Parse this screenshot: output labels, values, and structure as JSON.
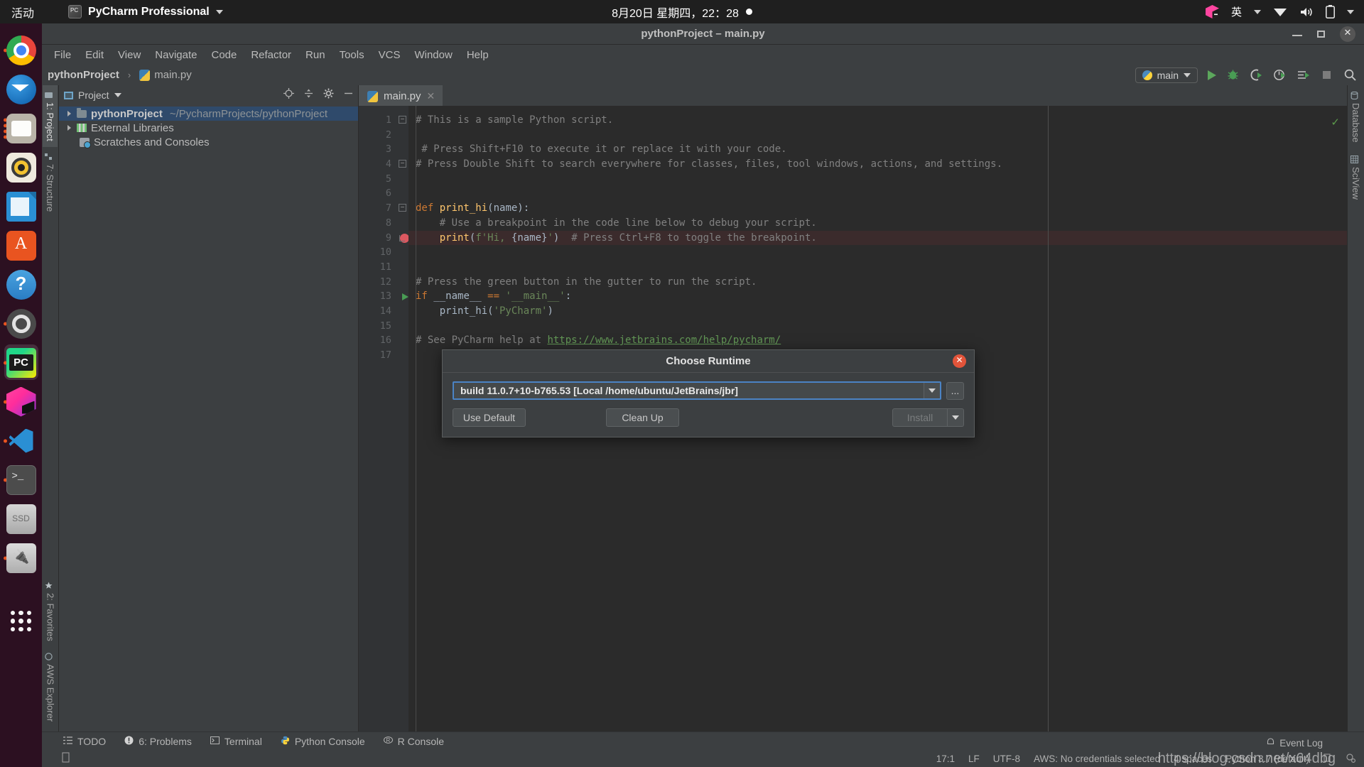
{
  "gnome": {
    "activities": "活动",
    "app_name": "PyCharm Professional",
    "app_icon": "pycharm-icon",
    "clock": "8月20日 星期四，22：28",
    "tray": {
      "lang": "英",
      "wifi_icon": "wifi-icon",
      "volume_icon": "volume-icon",
      "battery_icon": "battery-icon",
      "menu_icon": "chevron-down-icon",
      "jb_icon": "jetbrains-toolbox-icon"
    }
  },
  "dock": {
    "items": [
      {
        "name": "google-chrome",
        "running": true
      },
      {
        "name": "thunderbird-mail",
        "running": false
      },
      {
        "name": "files-nautilus",
        "running": true
      },
      {
        "name": "rhythmbox",
        "running": false
      },
      {
        "name": "libreoffice-writer",
        "running": false
      },
      {
        "name": "ubuntu-software",
        "running": false
      },
      {
        "name": "help",
        "running": false
      },
      {
        "name": "settings",
        "running": true
      },
      {
        "name": "pycharm",
        "running": true
      },
      {
        "name": "datagrip",
        "running": true
      },
      {
        "name": "vscode",
        "running": true
      },
      {
        "name": "terminal",
        "running": true
      },
      {
        "name": "ssd-volume",
        "running": false
      },
      {
        "name": "usb-volume",
        "running": true
      },
      {
        "name": "show-applications",
        "running": false
      }
    ]
  },
  "window": {
    "title": "pythonProject – main.py",
    "minimize_label": "minimize",
    "maximize_label": "restore",
    "close_label": "close"
  },
  "menubar": [
    {
      "label": "File"
    },
    {
      "label": "Edit"
    },
    {
      "label": "View"
    },
    {
      "label": "Navigate"
    },
    {
      "label": "Code"
    },
    {
      "label": "Refactor"
    },
    {
      "label": "Run"
    },
    {
      "label": "Tools"
    },
    {
      "label": "VCS"
    },
    {
      "label": "Window"
    },
    {
      "label": "Help"
    }
  ],
  "navbar": {
    "project": "pythonProject",
    "separator": "›",
    "file": "main.py",
    "run_config": "main",
    "actions": [
      "run-icon",
      "debug-icon",
      "run-with-coverage-icon",
      "profile-icon",
      "run-console-icon",
      "stop-icon",
      "search-everywhere-icon"
    ]
  },
  "left_tabs": [
    {
      "label": "1: Project",
      "selected": true,
      "icon": "project-icon"
    },
    {
      "label": "7: Structure",
      "selected": false,
      "icon": "structure-icon"
    },
    {
      "label": "2: Favorites",
      "selected": false,
      "icon": "star-icon"
    },
    {
      "label": "AWS Explorer",
      "selected": false,
      "icon": "aws-icon"
    }
  ],
  "right_tabs": [
    {
      "label": "Database",
      "icon": "database-icon"
    },
    {
      "label": "SciView",
      "icon": "sciview-icon"
    }
  ],
  "project_panel": {
    "title": "Project",
    "dropdown_icon": "chevron-down-icon",
    "actions": [
      "locate-icon",
      "collapse-all-icon",
      "settings-gear-icon",
      "hide-icon"
    ],
    "tree": [
      {
        "label": "pythonProject",
        "path": "~/PycharmProjects/pythonProject",
        "selected": true,
        "icon": "folder-icon",
        "expandable": true
      },
      {
        "label": "External Libraries",
        "path": "",
        "selected": false,
        "icon": "libraries-icon",
        "expandable": true
      },
      {
        "label": "Scratches and Consoles",
        "path": "",
        "selected": false,
        "icon": "scratches-icon",
        "expandable": false
      }
    ]
  },
  "editor": {
    "tab": {
      "label": "main.py",
      "icon": "python-file-icon",
      "close_icon": "close-icon"
    },
    "inspection_status": "✓",
    "lines": [
      {
        "n": 1,
        "fold": "minus",
        "marker": "",
        "tokens": [
          {
            "t": "# This is a sample Python script.",
            "c": "cmt"
          }
        ]
      },
      {
        "n": 2,
        "fold": "",
        "marker": "",
        "tokens": []
      },
      {
        "n": 3,
        "fold": "",
        "marker": "",
        "tokens": [
          {
            "t": " # Press Shift+F10 to execute it or replace it with your code.",
            "c": "cmt"
          }
        ]
      },
      {
        "n": 4,
        "fold": "minus",
        "marker": "",
        "tokens": [
          {
            "t": "# Press Double Shift to search everywhere for classes, files, tool windows, actions, and settings.",
            "c": "cmt"
          }
        ]
      },
      {
        "n": 5,
        "fold": "",
        "marker": "",
        "tokens": []
      },
      {
        "n": 6,
        "fold": "",
        "marker": "",
        "tokens": []
      },
      {
        "n": 7,
        "fold": "minus",
        "marker": "",
        "tokens": [
          {
            "t": "def ",
            "c": "kw"
          },
          {
            "t": "print_hi",
            "c": "fn"
          },
          {
            "t": "(name):",
            "c": "param"
          }
        ]
      },
      {
        "n": 8,
        "fold": "",
        "marker": "",
        "tokens": [
          {
            "t": "    # Use a breakpoint in the code line below to debug your script.",
            "c": "cmt"
          }
        ]
      },
      {
        "n": 9,
        "fold": "end",
        "marker": "breakpoint",
        "highlight": true,
        "tokens": [
          {
            "t": "    ",
            "c": "param"
          },
          {
            "t": "print",
            "c": "fn"
          },
          {
            "t": "(",
            "c": "brace"
          },
          {
            "t": "f'Hi, ",
            "c": "str"
          },
          {
            "t": "{",
            "c": "fstr-brace"
          },
          {
            "t": "name",
            "c": "param"
          },
          {
            "t": "}",
            "c": "fstr-brace"
          },
          {
            "t": "'",
            "c": "str"
          },
          {
            "t": ")  ",
            "c": "brace"
          },
          {
            "t": "# Press Ctrl+F8 to toggle the breakpoint.",
            "c": "cmt"
          }
        ]
      },
      {
        "n": 10,
        "fold": "",
        "marker": "",
        "tokens": []
      },
      {
        "n": 11,
        "fold": "",
        "marker": "",
        "tokens": []
      },
      {
        "n": 12,
        "fold": "",
        "marker": "",
        "tokens": [
          {
            "t": "# Press the green button in the gutter to run the script.",
            "c": "cmt"
          }
        ]
      },
      {
        "n": 13,
        "fold": "",
        "marker": "run",
        "tokens": [
          {
            "t": "if ",
            "c": "kw"
          },
          {
            "t": "__name__ ",
            "c": "param"
          },
          {
            "t": "== ",
            "c": "kw"
          },
          {
            "t": "'__main__'",
            "c": "str"
          },
          {
            "t": ":",
            "c": "param"
          }
        ]
      },
      {
        "n": 14,
        "fold": "",
        "marker": "",
        "tokens": [
          {
            "t": "    print_hi(",
            "c": "param"
          },
          {
            "t": "'PyCharm'",
            "c": "str"
          },
          {
            "t": ")",
            "c": "param"
          }
        ]
      },
      {
        "n": 15,
        "fold": "",
        "marker": "",
        "tokens": []
      },
      {
        "n": 16,
        "fold": "",
        "marker": "",
        "tokens": [
          {
            "t": "# See PyCharm help at ",
            "c": "cmt"
          },
          {
            "t": "https://www.jetbrains.com/help/pycharm/",
            "c": "link"
          }
        ]
      },
      {
        "n": 17,
        "fold": "",
        "marker": "",
        "tokens": []
      }
    ]
  },
  "dialog": {
    "title": "Choose Runtime",
    "close_icon": "close-icon",
    "combo_value": "build 11.0.7+10-b765.53 [Local /home/ubuntu/JetBrains/jbr]",
    "combo_arrow_icon": "chevron-down-icon",
    "ellipsis_label": "...",
    "buttons": {
      "use_default": "Use Default",
      "clean_up": "Clean Up",
      "install": "Install",
      "install_arrow_icon": "chevron-down-icon"
    }
  },
  "bottom_tools": [
    {
      "label": "TODO",
      "icon": "todo-icon"
    },
    {
      "label": "6: Problems",
      "icon": "problems-icon"
    },
    {
      "label": "Terminal",
      "icon": "terminal-icon"
    },
    {
      "label": "Python Console",
      "icon": "python-console-icon"
    },
    {
      "label": "R Console",
      "icon": "r-console-icon"
    }
  ],
  "statusbar": {
    "event_log": "Event Log",
    "event_log_icon": "bell-icon",
    "caret": "17:1",
    "line_separator": "LF",
    "encoding": "UTF-8",
    "aws": "AWS: No credentials selected",
    "indent": "4 spaces",
    "interpreter": "Python 3.7 (default)",
    "lock_icon": "read-only-icon",
    "inspections_icon": "inspections-icon"
  },
  "watermark": "https://blog.csdn.net/x64dbg"
}
